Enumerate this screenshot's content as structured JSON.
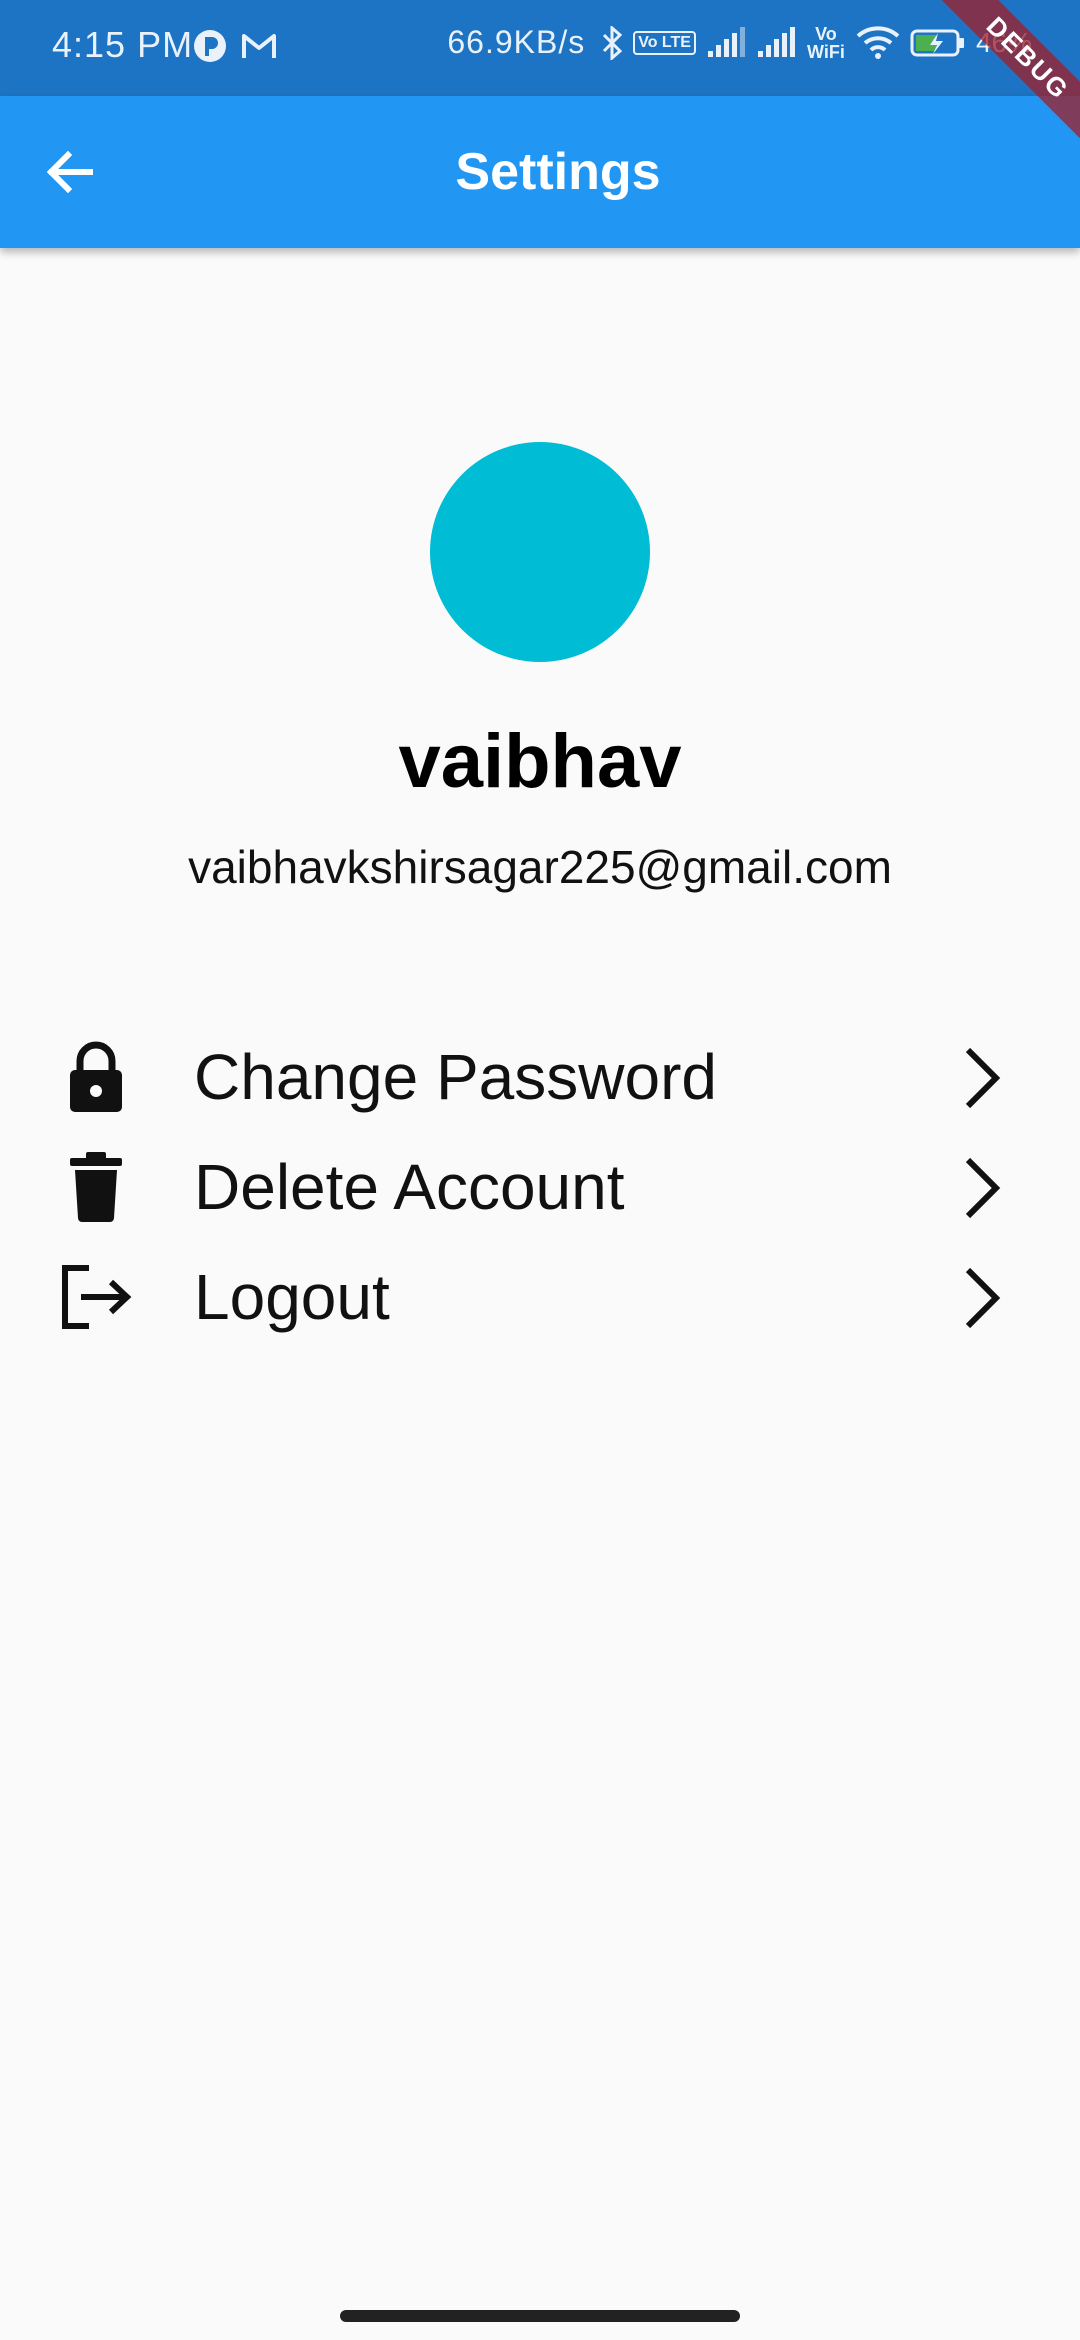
{
  "status_bar": {
    "time": "4:15 PM",
    "net_speed": "66.9KB/s",
    "volte_badge": "Vo LTE",
    "vowifi_label": "Vo WiFi",
    "battery_text": "46%",
    "icons": [
      "app-notification-icon",
      "gmail-icon",
      "bluetooth-icon",
      "signal-icon",
      "wifi-icon",
      "battery-charging-icon"
    ]
  },
  "debug_banner": "DEBUG",
  "app_bar": {
    "title": "Settings",
    "back_icon": "arrow-back-icon",
    "background": "#2196f3"
  },
  "profile": {
    "name": "vaibhav",
    "email": "vaibhavkshirsagar225@gmail.com",
    "avatar_color": "#00bcd4"
  },
  "menu": {
    "items": [
      {
        "label": "Change Password",
        "icon": "lock-icon"
      },
      {
        "label": "Delete Account",
        "icon": "trash-icon"
      },
      {
        "label": "Logout",
        "icon": "logout-icon"
      }
    ],
    "trailing_icon": "chevron-right-icon"
  }
}
